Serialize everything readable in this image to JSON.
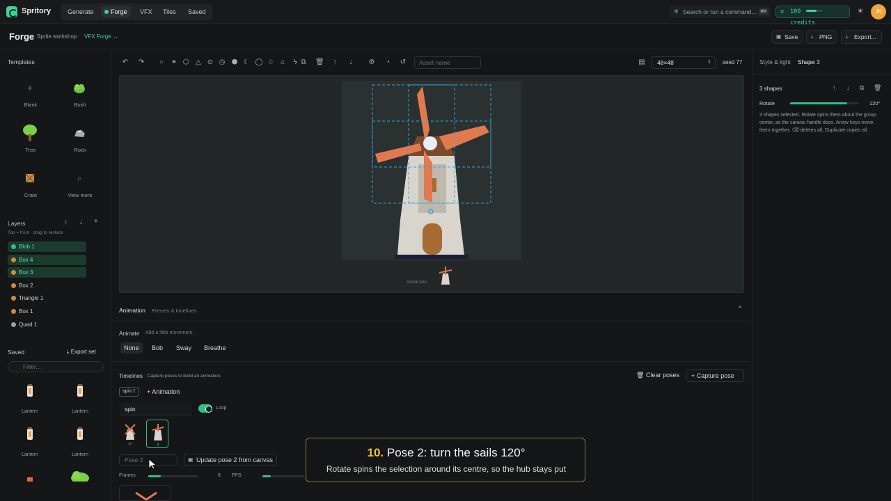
{
  "app": {
    "brand": "Spritory"
  },
  "nav": {
    "items": [
      "Generate",
      "Forge",
      "VFX",
      "Tiles",
      "Saved"
    ],
    "active": "Forge"
  },
  "search": {
    "placeholder": "Search or run a command...",
    "shortcut": "⌘K"
  },
  "credits": {
    "amount": "100",
    "label": "credits",
    "level": 0.6
  },
  "avatar_initial": "JK",
  "header": {
    "title": "Forge",
    "subtitle": "Sprite workshop",
    "link": "VFX Forge →",
    "save": "Save",
    "png": "PNG",
    "export": "Export..."
  },
  "templates": {
    "title": "Templates",
    "items": [
      "Blank",
      "Bush",
      "Tree",
      "Rock",
      "Crate",
      "View more"
    ]
  },
  "layers": {
    "title": "Layers",
    "hint": "Top = front · drag to restack",
    "items": [
      {
        "label": "Blob 1",
        "color": "#2fbf8a",
        "selected": true
      },
      {
        "label": "Box 4",
        "color": "#d08b3b",
        "selected": true
      },
      {
        "label": "Box 3",
        "color": "#d08b3b",
        "selected": true
      },
      {
        "label": "Box 2",
        "color": "#d08b3b",
        "selected": false
      },
      {
        "label": "Triangle 1",
        "color": "#d08b3b",
        "selected": false
      },
      {
        "label": "Box 1",
        "color": "#d08b3b",
        "selected": false
      },
      {
        "label": "Quad 1",
        "color": "#9aa0a3",
        "selected": false
      }
    ]
  },
  "saved": {
    "title": "Saved",
    "export": "Export set",
    "filter_placeholder": "Filter...",
    "items": [
      "Lantern",
      "Lantern",
      "Lantern",
      "Lantern"
    ]
  },
  "toolbar": {
    "asset_placeholder": "Asset name",
    "size": "48×48",
    "seed": "seed 77"
  },
  "canvas": {
    "actual_size": "Actual size"
  },
  "animation": {
    "title": "Animation",
    "subtitle": "Presets & timelines",
    "animate_label": "Animate",
    "animate_hint": "Add a little movement.",
    "presets": [
      "None",
      "Bob",
      "Sway",
      "Breathe"
    ],
    "timelines_label": "Timelines",
    "timelines_hint": "Capture poses to build an animation.",
    "clear": "Clear poses",
    "capture": "Capture pose",
    "tag": "spin",
    "tag_count": "2",
    "add_animation": "Animation",
    "name_value": "spin",
    "loop": "Loop",
    "frames": [
      {
        "label": "0°"
      },
      {
        "label": "2"
      }
    ],
    "pose_placeholder": "Pose 2",
    "update": "Update pose 2 from canvas",
    "frames_label": "Frames",
    "frames_value": "8",
    "fps_label": "FPS"
  },
  "right": {
    "tabs": [
      "Style & light",
      "Shape"
    ],
    "shape_count": "3",
    "shapes_title": "3 shapes",
    "rotate_label": "Rotate",
    "rotate_value": "120°",
    "rotate_fraction": 0.83,
    "description": "3 shapes selected. Rotate spins them about the group center, as the canvas handle does. Arrow keys move them together, ⌫ deletes all, Duplicate copies all."
  },
  "callout": {
    "num": "10.",
    "title": "Pose 2: turn the sails 120°",
    "text": "Rotate spins the selection around its centre, so the hub stays put"
  }
}
